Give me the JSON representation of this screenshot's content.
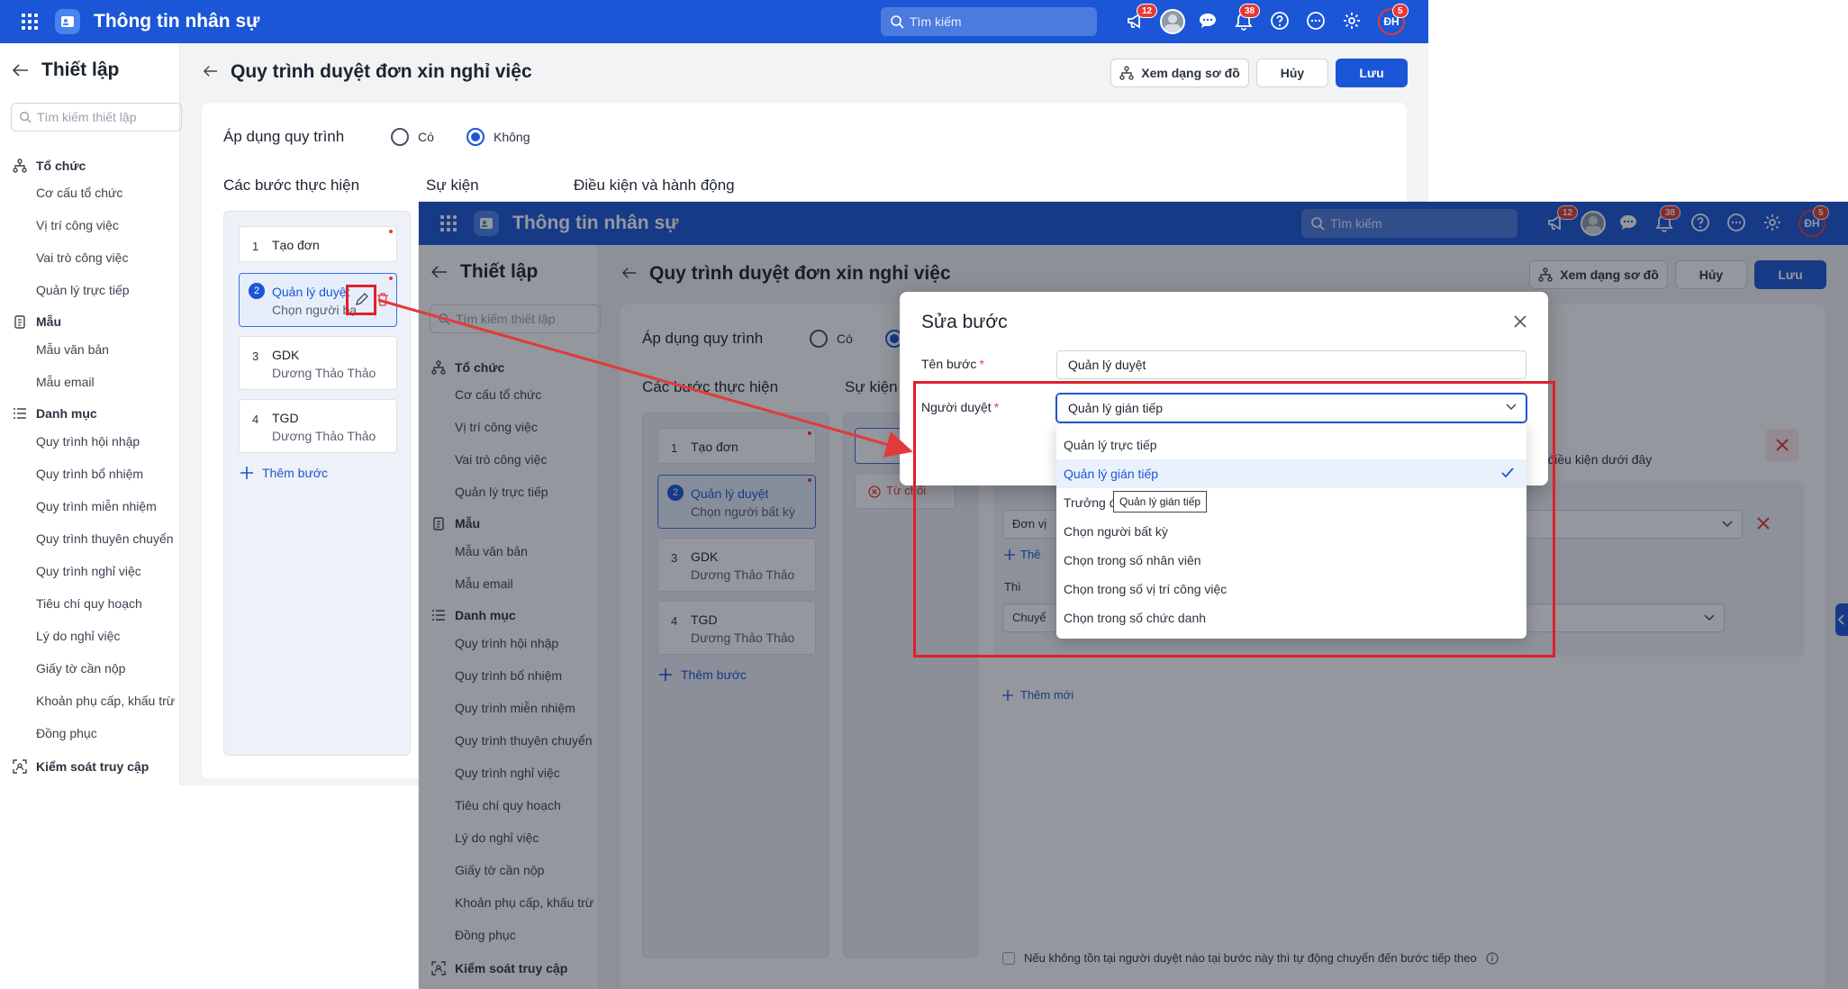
{
  "app": {
    "title": "Thông tin nhân sự",
    "search_placeholder": "Tìm kiếm",
    "badges": {
      "announcements": "12",
      "notifications": "38",
      "profile": "5"
    },
    "user_initials": "ĐH"
  },
  "sidebar": {
    "title": "Thiết lập",
    "search_placeholder": "Tìm kiếm thiết lập",
    "groups": {
      "org": "Tổ chức",
      "templates": "Mẫu",
      "catalog": "Danh mục",
      "access": "Kiểm soát truy cập"
    },
    "org_items": [
      "Cơ cấu tổ chức",
      "Vị trí công việc",
      "Vai trò công việc",
      "Quản lý trực tiếp"
    ],
    "template_items": [
      "Mẫu văn bản",
      "Mẫu email"
    ],
    "catalog_items": [
      "Quy trình hội nhập",
      "Quy trình bổ nhiệm",
      "Quy trình miễn nhiệm",
      "Quy trình thuyên chuyển",
      "Quy trình nghỉ việc",
      "Tiêu chí quy hoạch",
      "Lý do nghỉ việc",
      "Giấy tờ cần nộp",
      "Khoản phụ cấp, khấu trừ",
      "Đồng phục"
    ]
  },
  "page": {
    "title": "Quy trình duyệt đơn xin nghỉ việc",
    "buttons": {
      "diagram": "Xem dạng sơ đồ",
      "cancel": "Hủy",
      "save": "Lưu"
    },
    "apply_label": "Áp dụng quy trình",
    "radio_yes": "Có",
    "radio_no": "Không",
    "columns": {
      "steps": "Các bước thực hiện",
      "events": "Sự kiện",
      "conditions": "Điều kiện và hành động"
    },
    "steps": [
      {
        "no": "1",
        "name": "Tạo đơn",
        "sub": ""
      },
      {
        "no": "2",
        "name": "Quản lý duyệt",
        "sub": "Chọn người bất kỳ"
      },
      {
        "no": "3",
        "name": "GDK",
        "sub": "Dương Thảo Thảo"
      },
      {
        "no": "4",
        "name": "TGD",
        "sub": "Dương Thảo Thảo"
      }
    ],
    "add_step": "Thêm bước",
    "panel1_step2_sub": "Chọn người bạ"
  },
  "background": {
    "reject": "Từ chối",
    "cond_hint": "eo điều kiện dưới đây",
    "field_unit": "Đơn vị",
    "add_short": "Thê",
    "then_label": "Thì",
    "action_field": "Chuyể",
    "add_new": "Thêm mới",
    "auto_forward": "Nếu không tồn tại người duyệt nào tại bước này thì tự động chuyển đến bước tiếp theo"
  },
  "modal": {
    "title": "Sửa bước",
    "step_name_label": "Tên bước",
    "step_name_value": "Quản lý duyệt",
    "approver_label": "Người duyệt",
    "approver_value": "Quản lý gián tiếp",
    "options": [
      "Quản lý trực tiếp",
      "Quản lý gián tiếp",
      "Trưởng đ",
      "Chọn người bất kỳ",
      "Chọn trong số nhân viên",
      "Chọn trong số vị trí công việc",
      "Chọn trong số chức danh"
    ],
    "selected_index": 1,
    "tooltip": "Quản lý gián tiếp"
  },
  "colors": {
    "primary": "#1a56d6",
    "annotation": "#e0202a",
    "badge": "#e53935"
  }
}
